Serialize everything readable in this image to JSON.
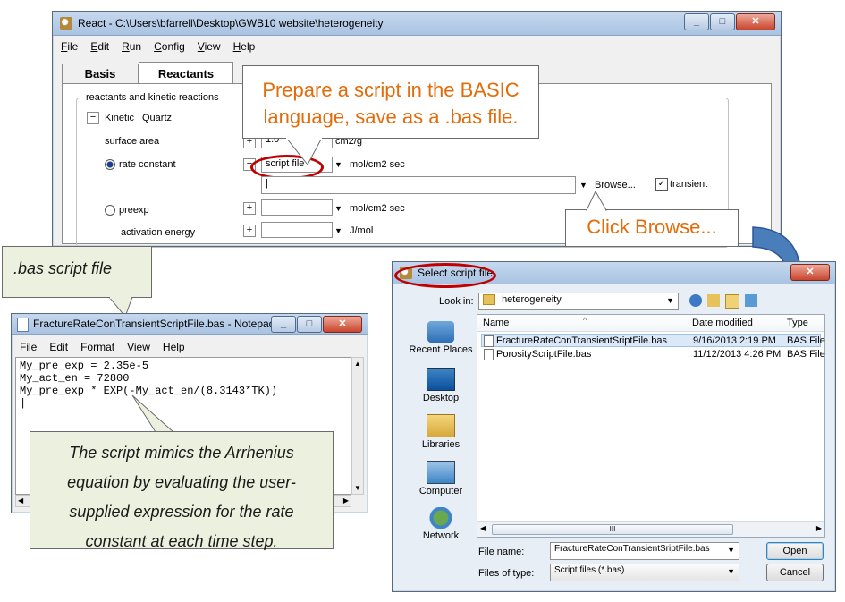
{
  "react_window": {
    "title": "React - C:\\Users\\bfarrell\\Desktop\\GWB10 website\\heterogeneity",
    "menu": [
      "File",
      "Edit",
      "Run",
      "Config",
      "View",
      "Help"
    ],
    "tabs": [
      "Basis",
      "Reactants"
    ],
    "group_title": "reactants and kinetic reactions",
    "kinetic_label": "Kinetic",
    "kinetic_mineral": "Quartz",
    "collapse_glyph": "−",
    "rows": {
      "surface_area_label": "surface area",
      "surface_area_value": "1.0",
      "surface_area_unit": "cm2/g",
      "rate_constant_label": "rate constant",
      "rate_constant_value": "script file",
      "rate_constant_unit": "mol/cm2 sec",
      "script_path_value": "|",
      "browse_label": "Browse...",
      "transient_label": "transient",
      "transient_check": "✓",
      "preexp_label": "preexp",
      "preexp_unit": "mol/cm2 sec",
      "activation_energy_label": "activation energy",
      "activation_energy_unit": "J/mol"
    }
  },
  "callouts": {
    "prepare_script": "Prepare a script in the BASIC language, save as a .bas file.",
    "click_browse": "Click Browse...",
    "bas_script_file": ".bas script file",
    "mimics_note": "The script mimics the Arrhenius equation by evaluating the user-supplied expression for the rate constant at each time step."
  },
  "notepad": {
    "title": "FractureRateConTransientScriptFile.bas - Notepad",
    "menu": [
      "File",
      "Edit",
      "Format",
      "View",
      "Help"
    ],
    "lines": [
      "My_pre_exp = 2.35e-5",
      "My_act_en = 72800",
      "My_pre_exp * EXP(-My_act_en/(8.3143*TK))",
      "|"
    ]
  },
  "dialog": {
    "title": "Select script file",
    "look_in_label": "Look in:",
    "look_in_value": "heterogeneity",
    "places": [
      "Recent Places",
      "Desktop",
      "Libraries",
      "Computer",
      "Network"
    ],
    "columns": [
      "Name",
      "Date modified",
      "Type"
    ],
    "sort_glyph": "^",
    "scroll_grip": "III",
    "files": [
      {
        "name": "FractureRateConTransientSriptFile.bas",
        "date": "9/16/2013 2:19 PM",
        "type": "BAS File"
      },
      {
        "name": "PorosityScriptFile.bas",
        "date": "11/12/2013 4:26 PM",
        "type": "BAS File"
      }
    ],
    "file_name_label": "File name:",
    "file_name_value": "FractureRateConTransientSriptFile.bas",
    "files_of_type_label": "Files of type:",
    "files_of_type_value": "Script files (*.bas)",
    "open_label": "Open",
    "cancel_label": "Cancel"
  },
  "colors": {
    "callout_text": "#e36c0a",
    "highlight_ring": "#c00000",
    "flow_arrow": "#4a7ebb",
    "note_bg": "#ebf1de"
  }
}
